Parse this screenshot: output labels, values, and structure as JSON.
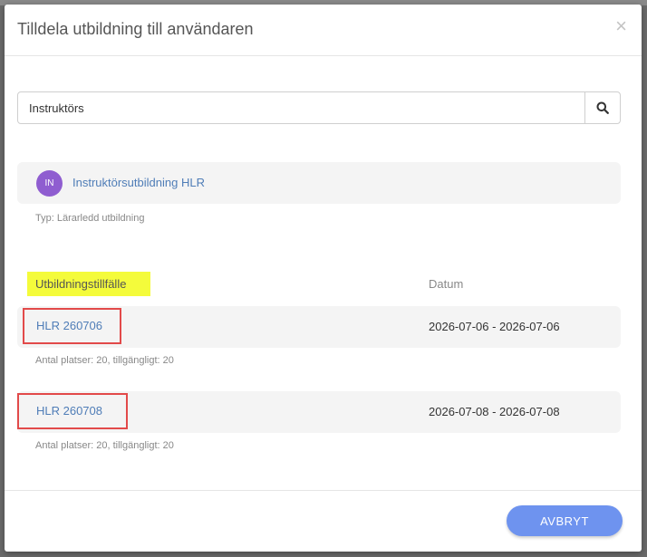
{
  "modal": {
    "title": "Tilldela utbildning till användaren",
    "close_label": "×"
  },
  "search": {
    "value": "Instruktörs",
    "icon": "search-icon"
  },
  "course": {
    "initials": "IN",
    "name": "Instruktörsutbildning HLR",
    "type": "Typ: Lärarledd utbildning",
    "avatar_color": "#8f5dd0"
  },
  "sessions_table": {
    "col_occasion": "Utbildningstillfälle",
    "col_date": "Datum",
    "highlight_color": "#f4fb3b",
    "rows": [
      {
        "name": "HLR 260706",
        "date": "2026-07-06 - 2026-07-06",
        "meta": "Antal platser: 20, tillgängligt: 20"
      },
      {
        "name": "HLR 260708",
        "date": "2026-07-08 - 2026-07-08",
        "meta": "Antal platser: 20, tillgängligt: 20"
      }
    ]
  },
  "footer": {
    "cancel_label": "AVBRYT",
    "cancel_color": "#6e93ef"
  }
}
